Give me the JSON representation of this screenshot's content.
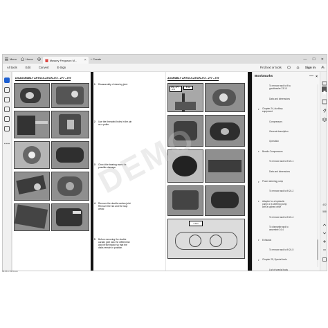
{
  "tabs": [
    {
      "label": "Menu"
    },
    {
      "label": "Home"
    },
    {
      "label": "Massey Ferguson M..."
    }
  ],
  "new_tab_label": "+ Create",
  "window": {
    "minimize": "—",
    "maximize": "☐",
    "close": "✕"
  },
  "menu": {
    "items": [
      "All tools",
      "Edit",
      "Convert",
      "E-Sign"
    ],
    "find_text": "Find text or tools",
    "sign_in": "Sign in"
  },
  "left_page": {
    "title": "DISASSEMBLY ARTICULATION 272 - 277 - 279",
    "steps": [
      {
        "num": "1",
        "text": "Disassembly of steering joint."
      },
      {
        "num": "2",
        "text": "Use the threaded holes in the pin\nas a puller."
      },
      {
        "num": "3",
        "text": "Check the bearing races for\npossible damage."
      },
      {
        "num": "4",
        "text": "Remove the double cardan joint.\nRemove the nut and the stop\narrow."
      },
      {
        "num": "5",
        "text": "Before removing the double\ncardan joint lock the differential\nand lift the tractor so that the\ndisks remain in position."
      }
    ]
  },
  "right_page": {
    "title": "ASSEMBLY ARTICULATION 272 - 277 - 279",
    "callouts": [
      "272 - 277\n- 279",
      "6 Nm",
      "4 Nm"
    ]
  },
  "watermark": "DEMO",
  "bookmarks": {
    "title": "Bookmarks",
    "items": [
      {
        "label": "To remove and to fit a\ngoodtrawler 23-10",
        "level": 2,
        "expand": false
      },
      {
        "label": "Data and dimensions",
        "level": 2,
        "expand": false
      },
      {
        "label": "Chapter 24, Auxiliary\nequipment",
        "level": 1,
        "expand": true
      },
      {
        "label": "Compressors",
        "level": 2,
        "expand": false
      },
      {
        "label": "General description",
        "level": 2,
        "expand": false
      },
      {
        "label": "Operation",
        "level": 2,
        "expand": false
      },
      {
        "label": "Bendix Compressors",
        "level": 1,
        "expand": true
      },
      {
        "label": "To remove and to fit 24-1",
        "level": 2,
        "expand": false
      },
      {
        "label": "Data and dimensions",
        "level": 2,
        "expand": false
      },
      {
        "label": "Power steering pump",
        "level": 1,
        "expand": true
      },
      {
        "label": "To remove and to fit 24-2",
        "level": 2,
        "expand": false
      },
      {
        "label": "Adapter for a hydraulic\npump or a steering pump\nwith a splined drive",
        "level": 1,
        "expand": true
      },
      {
        "label": "To remove and to fit 24-4",
        "level": 2,
        "expand": false
      },
      {
        "label": "To dismantle and to\nassemble 24-4",
        "level": 2,
        "expand": false
      },
      {
        "label": "Exhausts",
        "level": 1,
        "expand": true
      },
      {
        "label": "To remove and to fit 24-5",
        "level": 2,
        "expand": false
      },
      {
        "label": "Chapter 25, Special tools",
        "level": 1,
        "expand": true
      },
      {
        "label": "List of special tools",
        "level": 2,
        "expand": false
      }
    ]
  },
  "right_tools": {
    "page_current": "402",
    "page_total": "588"
  },
  "status_text": "96.96 x 29.69 cm",
  "colors": {
    "accent": "#1d5fd1",
    "window_bg": "#e9e9e9",
    "page_bg": "#ffffff"
  }
}
